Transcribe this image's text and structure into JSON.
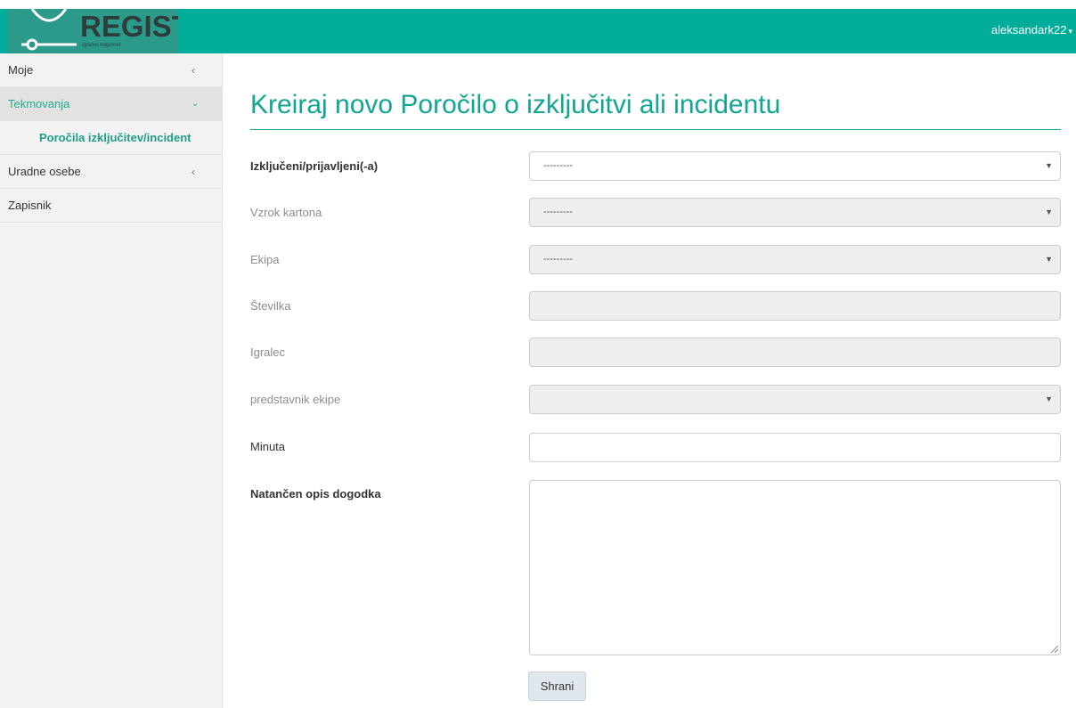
{
  "app": {
    "logo_text": "REGISTA",
    "logo_subtext": "igramo nogomet",
    "brand_color": "#00ad9a",
    "user_name": "aleksandark22"
  },
  "sidebar": {
    "items": [
      {
        "label": "Moje",
        "icon": "chevron-left-icon"
      },
      {
        "label": "Tekmovanja",
        "icon": "chevron-down-icon",
        "active": true
      },
      {
        "label": "Poročila izključitev/incident",
        "submenu": true
      },
      {
        "label": "Uradne osebe",
        "icon": "chevron-left-icon"
      },
      {
        "label": "Zapisnik"
      }
    ]
  },
  "page": {
    "title": "Kreiraj novo Poročilo o izključitvi ali incidentu"
  },
  "form": {
    "fields": [
      {
        "label": "Izključeni/prijavljeni(-a)",
        "type": "select",
        "value": "---------",
        "disabled": false
      },
      {
        "label": "Vzrok kartona",
        "type": "select",
        "value": "---------",
        "disabled": true
      },
      {
        "label": "Ekipa",
        "type": "select",
        "value": "---------",
        "disabled": true
      },
      {
        "label": "Številka",
        "type": "text",
        "value": "",
        "disabled": true
      },
      {
        "label": "Igralec",
        "type": "text",
        "value": "",
        "disabled": true
      },
      {
        "label": "predstavnik ekipe",
        "type": "select",
        "value": "",
        "disabled": true
      },
      {
        "label": "Minuta",
        "type": "text",
        "value": "",
        "disabled": false
      },
      {
        "label": "Natančen opis dogodka",
        "type": "textarea",
        "value": "",
        "disabled": false
      }
    ],
    "save_label": "Shrani"
  }
}
